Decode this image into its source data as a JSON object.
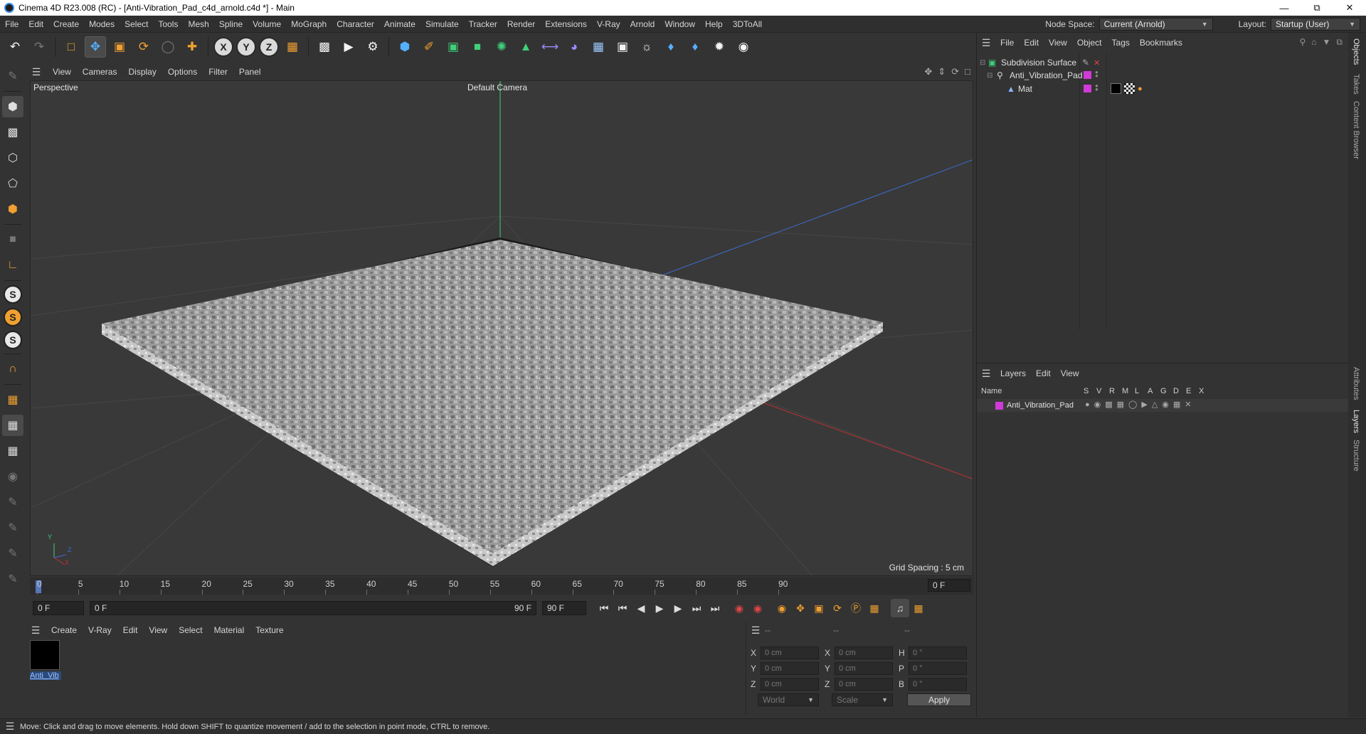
{
  "window": {
    "title": "Cinema 4D R23.008 (RC) - [Anti-Vibration_Pad_c4d_arnold.c4d *] - Main",
    "controls": [
      "minimize-icon",
      "restore-icon",
      "close-icon"
    ]
  },
  "menubar": {
    "items": [
      "File",
      "Edit",
      "Create",
      "Modes",
      "Select",
      "Tools",
      "Mesh",
      "Spline",
      "Volume",
      "MoGraph",
      "Character",
      "Animate",
      "Simulate",
      "Tracker",
      "Render",
      "Extensions",
      "V-Ray",
      "Arnold",
      "Window",
      "Help",
      "3DToAll"
    ],
    "node_space_label": "Node Space:",
    "node_space_value": "Current (Arnold)",
    "layout_label": "Layout:",
    "layout_value": "Startup (User)"
  },
  "viewport": {
    "menu": [
      "View",
      "Cameras",
      "Display",
      "Options",
      "Filter",
      "Panel"
    ],
    "label": "Perspective",
    "camera": "Default Camera",
    "grid_spacing": "Grid Spacing : 5 cm",
    "axis_labels": [
      "Y",
      "Z",
      "X"
    ]
  },
  "timeline": {
    "ticks": [
      "0",
      "5",
      "10",
      "15",
      "20",
      "25",
      "30",
      "35",
      "40",
      "45",
      "50",
      "55",
      "60",
      "65",
      "70",
      "75",
      "80",
      "85",
      "90"
    ],
    "current_frame_right": "0 F",
    "start_field": "0 F",
    "range_start": "0 F",
    "range_end": "90 F",
    "end_field": "90 F"
  },
  "material_manager": {
    "menu": [
      "Create",
      "V-Ray",
      "Edit",
      "View",
      "Select",
      "Material",
      "Texture"
    ],
    "material_name": "Anti_Vib",
    "swatch_color": "#000000"
  },
  "coordinates": {
    "headers": [
      "--",
      "--",
      "--"
    ],
    "rows": [
      {
        "a": "X",
        "av": "0 cm",
        "b": "X",
        "bv": "0 cm",
        "c": "H",
        "cv": "0 °"
      },
      {
        "a": "Y",
        "av": "0 cm",
        "b": "Y",
        "bv": "0 cm",
        "c": "P",
        "cv": "0 °"
      },
      {
        "a": "Z",
        "av": "0 cm",
        "b": "Z",
        "bv": "0 cm",
        "c": "B",
        "cv": "0 °"
      }
    ],
    "mode1": "World",
    "mode2": "Scale",
    "apply": "Apply"
  },
  "status": {
    "message": "Move: Click and drag to move elements. Hold down SHIFT to quantize movement / add to the selection in point mode, CTRL to remove."
  },
  "objects_panel": {
    "menu": [
      "File",
      "Edit",
      "View",
      "Object",
      "Tags",
      "Bookmarks"
    ],
    "objects": [
      {
        "name": "Subdivision Surface",
        "icon": "subdivision-icon"
      },
      {
        "name": "Anti_Vibration_Pad",
        "icon": "null-object-icon"
      },
      {
        "name": "Mat",
        "icon": "polygon-object-icon"
      }
    ],
    "layer_color": "#d03ad8"
  },
  "layers_panel": {
    "menu": [
      "Layers",
      "Edit",
      "View"
    ],
    "columns": [
      "Name",
      "S",
      "V",
      "R",
      "M",
      "L",
      "A",
      "G",
      "D",
      "E",
      "X"
    ],
    "layers": [
      {
        "name": "Anti_Vibration_Pad",
        "color": "#d03ad8"
      }
    ]
  },
  "side_tabs": [
    "Objects",
    "Takes",
    "Content Browser",
    "Attributes",
    "Layers",
    "Structure"
  ]
}
